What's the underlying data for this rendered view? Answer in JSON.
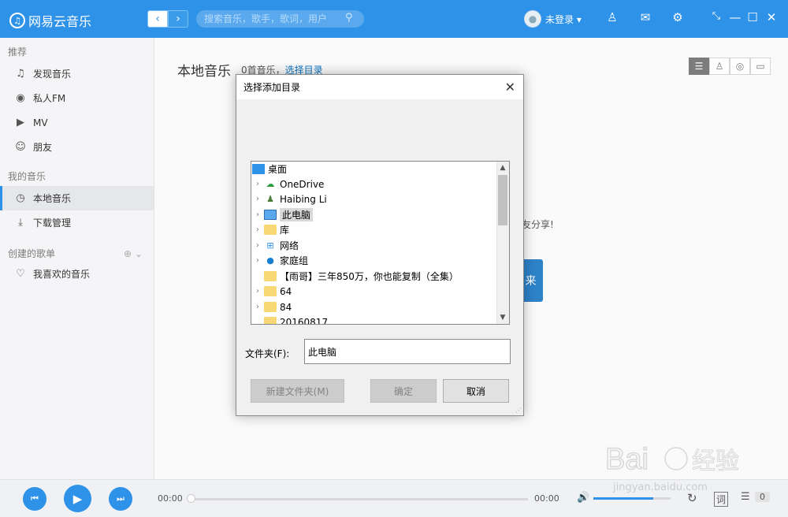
{
  "app": {
    "name": "网易云音乐"
  },
  "header": {
    "search_placeholder": "搜索音乐，歌手，歌词，用户",
    "user": "未登录 ▾"
  },
  "sidebar": {
    "recommend": "推荐",
    "items_recommend": [
      {
        "label": "发现音乐",
        "icon": "music-note-icon"
      },
      {
        "label": "私人FM",
        "icon": "radio-icon"
      },
      {
        "label": "MV",
        "icon": "video-icon"
      },
      {
        "label": "朋友",
        "icon": "friends-icon"
      }
    ],
    "my_music": "我的音乐",
    "items_my": [
      {
        "label": "本地音乐",
        "icon": "clock-icon"
      },
      {
        "label": "下载管理",
        "icon": "download-icon"
      }
    ],
    "created": "创建的歌单",
    "items_created": [
      {
        "label": "我喜欢的音乐",
        "icon": "heart-icon"
      }
    ]
  },
  "main": {
    "title": "本地音乐",
    "count": "0首音乐，",
    "select_dir": "选择目录",
    "share_text": "友分享!",
    "btn_fragment": "来"
  },
  "dialog": {
    "title": "选择添加目录",
    "tree": [
      "桌面",
      "OneDrive",
      "Haibing Li",
      "此电脑",
      "库",
      "网络",
      "家庭组",
      "【雨哥】三年850万，你也能复制（全集）",
      "64",
      "84",
      "20160817"
    ],
    "folder_label": "文件夹(F):",
    "folder_value": "此电脑",
    "new_folder": "新建文件夹(M)",
    "ok": "确定",
    "cancel": "取消"
  },
  "player": {
    "time_current": "00:00",
    "time_total": "00:00",
    "volume_level": 0.78,
    "lyrics_btn": "词",
    "playlist_count": "0"
  },
  "watermark": "Baidu经验 jingyan.baidu.com"
}
